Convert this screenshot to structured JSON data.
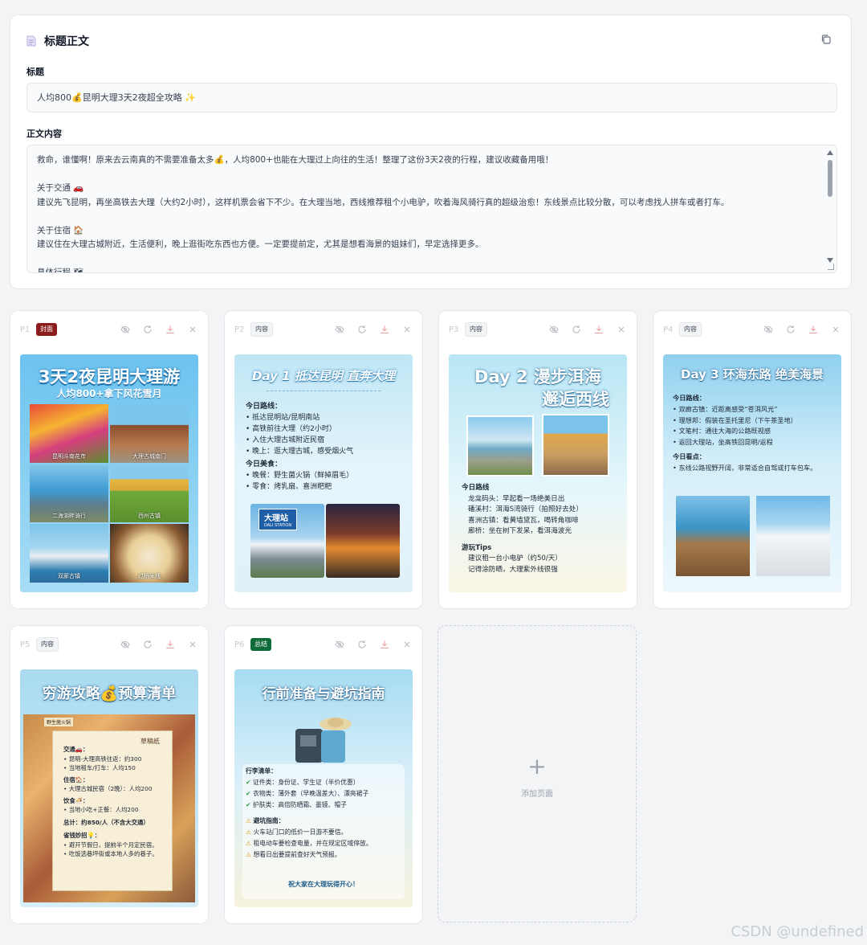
{
  "editor": {
    "heading": "标题正文",
    "title_label": "标题",
    "title_value": "人均800💰昆明大理3天2夜超全攻略 ✨",
    "body_label": "正文内容",
    "body_lines": [
      "救命，谁懂啊！原来去云南真的不需要准备太多💰，人均800+也能在大理过上向往的生活！整理了这份3天2夜的行程，建议收藏备用哦！",
      "",
      "关于交通 🚗",
      "建议先飞昆明，再坐高铁去大理（大约2小时），这样机票会省下不少。在大理当地，西线推荐租个小电驴，吹着海风骑行真的超级治愈！东线景点比较分散，可以考虑找人拼车或者打车。",
      "",
      "关于住宿 🏠",
      "建议住在大理古城附近，生活便利，晚上逛街吃东西也方便。一定要提前定，尤其是想看海景的姐妹们，早定选择更多。",
      "",
      "具体行程 🗺"
    ]
  },
  "pages": [
    {
      "num": "P1",
      "badge": "封面",
      "title": "3天2夜昆明大理游",
      "subtitle": "人均800+拿下风花雪月",
      "captions": [
        "昆明斗南花市",
        "大理古城南门",
        "二海湖畔骑行",
        "西州古镇",
        "双廊古镇",
        "过桥米线"
      ]
    },
    {
      "num": "P2",
      "badge": "内容",
      "title": "Day 1 抵达昆明 直奔大理",
      "route_h": "今日路线：",
      "route": [
        "抵达昆明站/昆明南站",
        "高铁前往大理（约2小时）",
        "入住大理古城附近民宿",
        "晚上：逛大理古城，感受烟火气"
      ],
      "food_h": "今日美食：",
      "food": [
        "晚餐：野生菌火锅（鲜掉眉毛）",
        "零食：烤乳扇、喜洲粑粑"
      ],
      "sign": "大理站",
      "sign_sub": "DALI STATION"
    },
    {
      "num": "P3",
      "badge": "内容",
      "title_line1": "Day 2 漫步洱海",
      "title_line2": "邂逅西线",
      "route_h": "今日路线",
      "route": [
        "龙龛码头：早起看一场绝美日出",
        "磻溪村：洱海S湾骑行（拍照好去处）",
        "喜洲古镇：看黄墙黛瓦，喝转角咖啡",
        "廊桥：坐在树下发呆，看洱海波光"
      ],
      "tips_h": "游玩Tips",
      "tips": [
        "建议租一台小电驴（约50/天）",
        "记得涂防晒，大理紫外线很强"
      ]
    },
    {
      "num": "P4",
      "badge": "内容",
      "title": "Day 3 环海东路 绝美海景",
      "route_h": "今日路线：",
      "route": [
        "双廊古镇：近距离感受“苍洱风光”",
        "理想邦：假装在圣托里尼（下午茶圣地）",
        "文笔村：通往大海的公路既视感",
        "返回大理站，坐高铁回昆明/返程"
      ],
      "spot_h": "今日看点：",
      "spot": "东线公路视野开阔，非常适合自驾或打车包车。"
    },
    {
      "num": "P5",
      "badge": "内容",
      "title": "穷游攻略💰预算清单",
      "paper_tag": "草稿纸",
      "corner_tag": "野生菌火锅",
      "traffic_h": "交通🚗：",
      "traffic": [
        "昆明-大理高铁往返：约300",
        "当地租车/打车：人均150"
      ],
      "stay_h": "住宿🏠：",
      "stay": [
        "大理古城民宿（2晚）：人均200"
      ],
      "food_h": "饮食🍜：",
      "food": [
        "当地小吃+正餐：人均200"
      ],
      "total": "总计：约850/人（不含大交通）",
      "save_h": "省钱妙招💡：",
      "save": [
        "避开节假日，提前半个月定民宿。",
        "吃饭选巷坪街或本地人多的巷子。"
      ]
    },
    {
      "num": "P6",
      "badge": "总结",
      "title": "行前准备与避坑指南",
      "list_h": "行李清单：",
      "list": [
        "证件类：身份证、学生证（半价优惠）",
        "衣物类：薄外套（早晚温差大）、漂亮裙子",
        "护肤类：高倍防晒霜、墨镜、帽子"
      ],
      "warn_h": "避坑指南：",
      "warn": [
        "火车站门口的低价一日游不要信。",
        "租电动车要检查电量，并在规定区域停放。",
        "想看日出要提前查好天气预报。"
      ],
      "footer": "祝大家在大理玩得开心！"
    }
  ],
  "add_page": {
    "plus": "+",
    "label": "添加页面"
  },
  "watermark": "CSDN @undefined",
  "colors": {
    "cover_badge": "#8b1c1c",
    "summary_badge": "#0f6b3a",
    "sky": "#6cc3ef"
  }
}
